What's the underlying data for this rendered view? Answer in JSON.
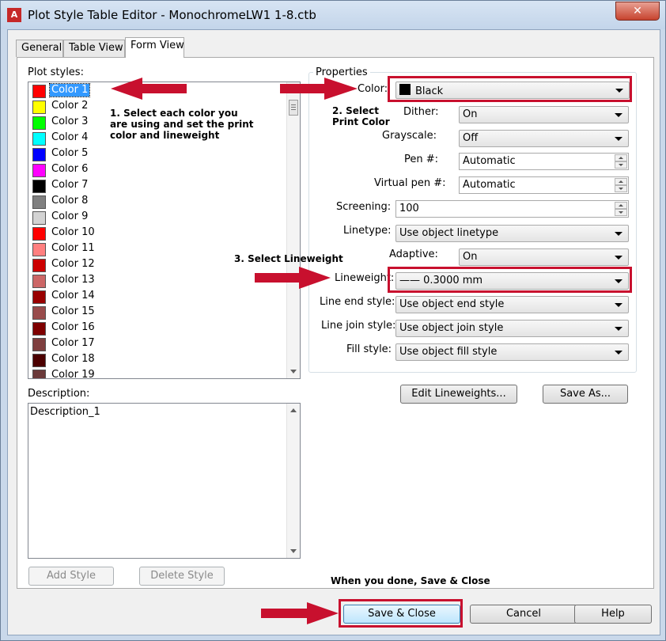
{
  "window": {
    "title": "Plot Style Table Editor - MonochromeLW1 1-8.ctb",
    "close_label": "✕",
    "app_icon": "A"
  },
  "tabs": [
    "General",
    "Table View",
    "Form View"
  ],
  "plot_styles_label": "Plot styles:",
  "plot_styles": [
    {
      "name": "Color 1",
      "color": "#ff0000"
    },
    {
      "name": "Color 2",
      "color": "#ffff00"
    },
    {
      "name": "Color 3",
      "color": "#00ff00"
    },
    {
      "name": "Color 4",
      "color": "#00ffff"
    },
    {
      "name": "Color 5",
      "color": "#0000ff"
    },
    {
      "name": "Color 6",
      "color": "#ff00ff"
    },
    {
      "name": "Color 7",
      "color": "#000000"
    },
    {
      "name": "Color 8",
      "color": "#808080"
    },
    {
      "name": "Color 9",
      "color": "#d3d3d3"
    },
    {
      "name": "Color 10",
      "color": "#ff0000"
    },
    {
      "name": "Color 11",
      "color": "#ff7f7f"
    },
    {
      "name": "Color 12",
      "color": "#cc0000"
    },
    {
      "name": "Color 13",
      "color": "#cc6666"
    },
    {
      "name": "Color 14",
      "color": "#990000"
    },
    {
      "name": "Color 15",
      "color": "#994c4c"
    },
    {
      "name": "Color 16",
      "color": "#7f0000"
    },
    {
      "name": "Color 17",
      "color": "#7f3f3f"
    },
    {
      "name": "Color 18",
      "color": "#4c0000"
    },
    {
      "name": "Color 19",
      "color": "#6b3a3a"
    }
  ],
  "description_label": "Description:",
  "description_value": "Description_1",
  "add_style_label": "Add Style",
  "delete_style_label": "Delete Style",
  "properties": {
    "group_label": "Properties",
    "color_label": "Color:",
    "color_value": "Black",
    "dither_label": "Dither:",
    "dither_value": "On",
    "grayscale_label": "Grayscale:",
    "grayscale_value": "Off",
    "pen_label": "Pen #:",
    "pen_value": "Automatic",
    "virtual_pen_label": "Virtual pen #:",
    "virtual_pen_value": "Automatic",
    "screening_label": "Screening:",
    "screening_value": "100",
    "linetype_label": "Linetype:",
    "linetype_value": "Use object linetype",
    "adaptive_label": "Adaptive:",
    "adaptive_value": "On",
    "lineweight_label": "Lineweight:",
    "lineweight_value": "—— 0.3000 mm",
    "line_end_label": "Line end style:",
    "line_end_value": "Use object end style",
    "line_join_label": "Line join style:",
    "line_join_value": "Use object join style",
    "fill_label": "Fill style:",
    "fill_value": "Use object fill style"
  },
  "edit_lineweights_label": "Edit Lineweights...",
  "save_as_label": "Save As...",
  "footer": {
    "save_close_label": "Save & Close",
    "cancel_label": "Cancel",
    "help_label": "Help"
  },
  "annotations": {
    "step1_line1": "1. Select each color you",
    "step1_line2": "are using and set the print",
    "step1_line3": "color and lineweight",
    "step2_line1": "2. Select",
    "step2_line2": "Print Color",
    "step3": "3. Select Lineweight",
    "final": "When you done, Save & Close"
  },
  "annotation_color": "#c8102e"
}
